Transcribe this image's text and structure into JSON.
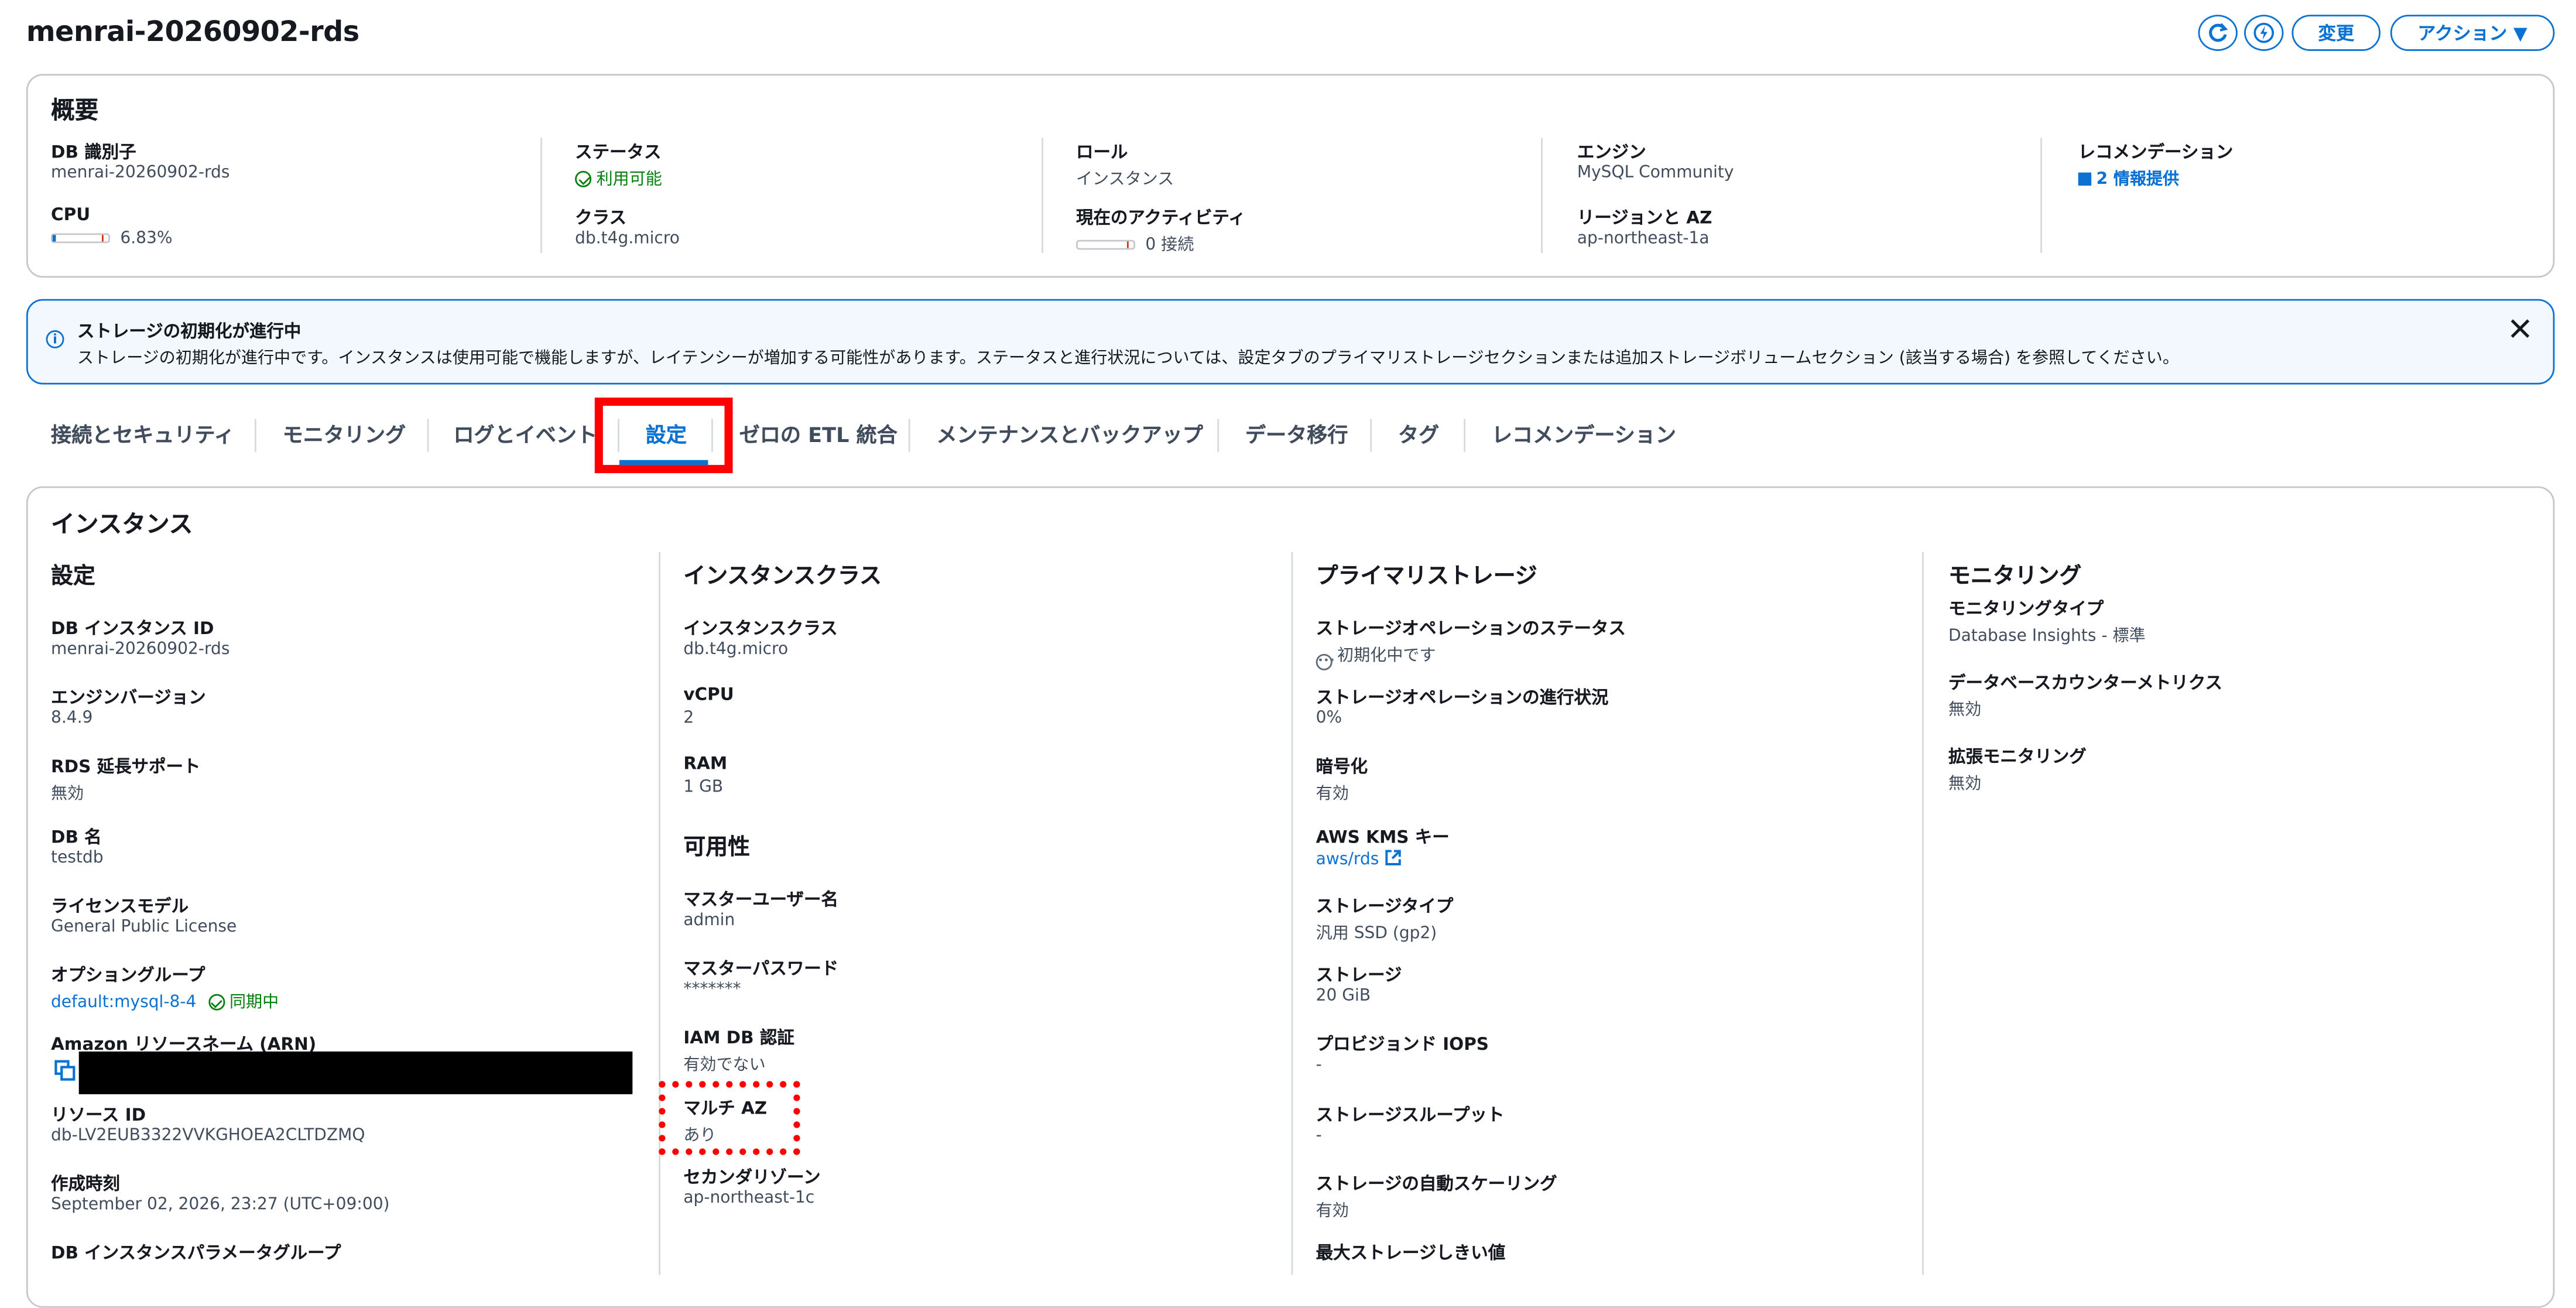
{
  "header": {
    "title": "menrai-20260902-rds",
    "modify_label": "変更",
    "actions_label": "アクション ▼"
  },
  "summary": {
    "title": "概要",
    "db_identifier_label": "DB 識別子",
    "db_identifier": "menrai-20260902-rds",
    "cpu_label": "CPU",
    "cpu_value": "6.83%",
    "cpu_fraction": 0.0683,
    "status_label": "ステータス",
    "status_value": "利用可能",
    "class_label": "クラス",
    "class_value": "db.t4g.micro",
    "role_label": "ロール",
    "role_value": "インスタンス",
    "activity_label": "現在のアクティビティ",
    "activity_value": "0 接続",
    "engine_label": "エンジン",
    "engine_value": "MySQL Community",
    "region_label": "リージョンと AZ",
    "region_value": "ap-northeast-1a",
    "recommendation_label": "レコメンデーション",
    "recommendation_value": "2 情報提供"
  },
  "flash": {
    "title": "ストレージの初期化が進行中",
    "message": "ストレージの初期化が進行中です。インスタンスは使用可能で機能しますが、レイテンシーが増加する可能性があります。ステータスと進行状況については、設定タブのプライマリストレージセクションまたは追加ストレージボリュームセクション (該当する場合) を参照してください。"
  },
  "tabs": [
    {
      "label": "接続とセキュリティ"
    },
    {
      "label": "モニタリング"
    },
    {
      "label": "ログとイベント"
    },
    {
      "label": "設定"
    },
    {
      "label": "ゼロの ETL 統合"
    },
    {
      "label": "メンテナンスとバックアップ"
    },
    {
      "label": "データ移行"
    },
    {
      "label": "タグ"
    },
    {
      "label": "レコメンデーション"
    }
  ],
  "instance": {
    "title": "インスタンス",
    "config": {
      "title": "設定",
      "instance_id_label": "DB インスタンス ID",
      "instance_id": "menrai-20260902-rds",
      "engine_version_label": "エンジンバージョン",
      "engine_version": "8.4.9",
      "extended_support_label": "RDS 延長サポート",
      "extended_support": "無効",
      "db_name_label": "DB 名",
      "db_name": "testdb",
      "license_label": "ライセンスモデル",
      "license": "General Public License",
      "option_group_label": "オプショングループ",
      "option_group": "default:mysql-8-4",
      "option_group_status": "同期中",
      "arn_label": "Amazon リソースネーム (ARN)",
      "resource_id_label": "リソース ID",
      "resource_id": "db-LV2EUB3322VVKGHOEA2CLTDZMQ",
      "created_label": "作成時刻",
      "created": "September 02, 2026, 23:27 (UTC+09:00)",
      "param_group_label": "DB インスタンスパラメータグループ"
    },
    "class": {
      "title": "インスタンスクラス",
      "class_label": "インスタンスクラス",
      "class_value": "db.t4g.micro",
      "vcpu_label": "vCPU",
      "vcpu": "2",
      "ram_label": "RAM",
      "ram": "1 GB"
    },
    "availability": {
      "title": "可用性",
      "master_user_label": "マスターユーザー名",
      "master_user": "admin",
      "master_password_label": "マスターパスワード",
      "master_password": "*******",
      "iam_label": "IAM DB 認証",
      "iam": "有効でない",
      "multi_az_label": "マルチ AZ",
      "multi_az": "あり",
      "secondary_zone_label": "セカンダリゾーン",
      "secondary_zone": "ap-northeast-1c"
    },
    "storage": {
      "title": "プライマリストレージ",
      "op_status_label": "ストレージオペレーションのステータス",
      "op_status": "初期化中です",
      "op_progress_label": "ストレージオペレーションの進行状況",
      "op_progress": "0%",
      "encryption_label": "暗号化",
      "encryption": "有効",
      "kms_label": "AWS KMS キー",
      "kms": "aws/rds",
      "type_label": "ストレージタイプ",
      "type": "汎用 SSD (gp2)",
      "size_label": "ストレージ",
      "size": "20 GiB",
      "iops_label": "プロビジョンド IOPS",
      "iops": "-",
      "throughput_label": "ストレージスループット",
      "throughput": "-",
      "autoscaling_label": "ストレージの自動スケーリング",
      "autoscaling": "有効",
      "max_threshold_label": "最大ストレージしきい値"
    },
    "monitoring": {
      "title": "モニタリング",
      "type_label": "モニタリングタイプ",
      "type": "Database Insights - 標準",
      "counter_label": "データベースカウンターメトリクス",
      "counter": "無効",
      "enhanced_label": "拡張モニタリング",
      "enhanced": "無効"
    }
  },
  "colors": {
    "accent": "#0972d3",
    "success": "#037f0c",
    "highlight": "#ff0000"
  }
}
